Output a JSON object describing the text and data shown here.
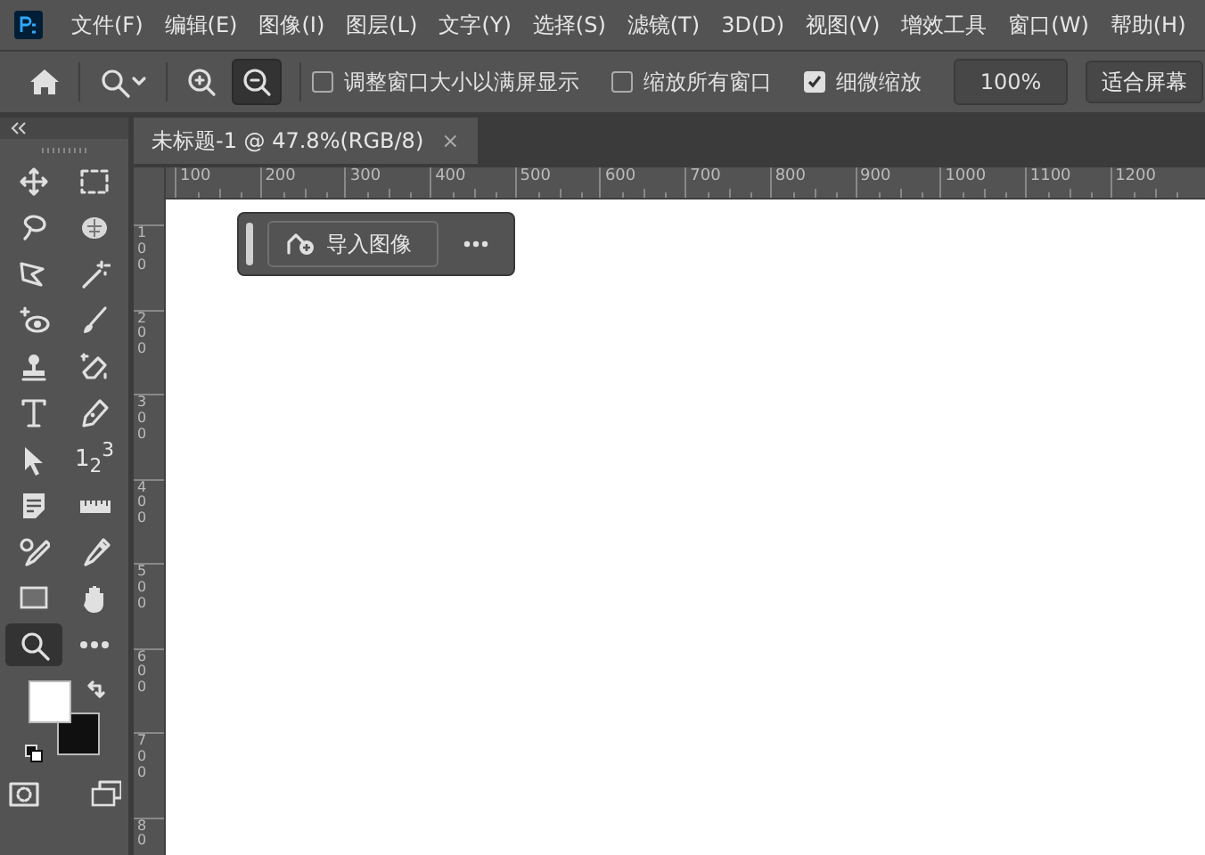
{
  "menu": [
    "文件(F)",
    "编辑(E)",
    "图像(I)",
    "图层(L)",
    "文字(Y)",
    "选择(S)",
    "滤镜(T)",
    "3D(D)",
    "视图(V)",
    "增效工具",
    "窗口(W)",
    "帮助(H)"
  ],
  "options_bar": {
    "zoom_buttons": [
      {
        "kind": "zoom-in",
        "selected": false
      },
      {
        "kind": "zoom-out",
        "selected": true
      }
    ],
    "checkboxes": [
      {
        "label": "调整窗口大小以满屏显示",
        "checked": false
      },
      {
        "label": "缩放所有窗口",
        "checked": false
      },
      {
        "label": "细微缩放",
        "checked": true
      }
    ],
    "zoom_field": {
      "value": "100%"
    },
    "fit_button": "适合屏幕"
  },
  "tools": [
    {
      "kind": "move",
      "selected": false
    },
    {
      "kind": "marquee",
      "selected": false
    },
    {
      "kind": "lasso",
      "selected": false
    },
    {
      "kind": "quick-select",
      "selected": false
    },
    {
      "kind": "frame",
      "selected": false
    },
    {
      "kind": "wand",
      "selected": false
    },
    {
      "kind": "eye",
      "selected": false
    },
    {
      "kind": "brush",
      "selected": false
    },
    {
      "kind": "stamp",
      "selected": false
    },
    {
      "kind": "eraser",
      "selected": false
    },
    {
      "kind": "type",
      "selected": false
    },
    {
      "kind": "pen",
      "selected": false
    },
    {
      "kind": "pointer",
      "selected": false
    },
    {
      "kind": "count",
      "selected": false,
      "text": "1$_{2}$$^{3}$"
    },
    {
      "kind": "note",
      "selected": false
    },
    {
      "kind": "ruler",
      "selected": false
    },
    {
      "kind": "sampler",
      "selected": false
    },
    {
      "kind": "eyedropper",
      "selected": false
    },
    {
      "kind": "rectangle",
      "selected": false
    },
    {
      "kind": "hand",
      "selected": false
    },
    {
      "kind": "zoom",
      "selected": true
    },
    {
      "kind": "more",
      "selected": false
    },
    {
      "kind": "quick-mask",
      "selected": false
    },
    {
      "kind": "screen-mode",
      "selected": false
    }
  ],
  "color_swatches": [
    {
      "kind": "foreground",
      "color": "#ffffff"
    },
    {
      "kind": "background",
      "color": "#101010"
    }
  ],
  "document_tab": {
    "title": "未标题-1 @ 47.8%(RGB/8)",
    "close": "×",
    "selected": true
  },
  "rulers": {
    "horizontal": [
      "100",
      "200",
      "300",
      "400",
      "500",
      "600",
      "700",
      "800",
      "900",
      "1000",
      "1100",
      "1200"
    ],
    "vertical": [
      "100",
      "200",
      "300",
      "400",
      "500",
      "600",
      "700",
      "80"
    ]
  },
  "contextual_bar": {
    "import_button": "导入图像"
  }
}
